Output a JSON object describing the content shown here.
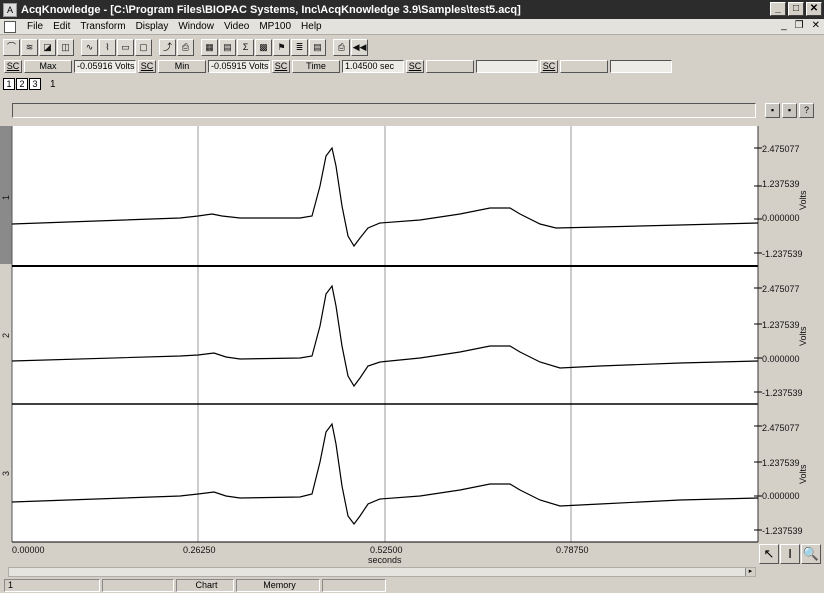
{
  "window": {
    "title": "AcqKnowledge - [C:\\Program Files\\BIOPAC Systems, Inc\\AcqKnowledge 3.9\\Samples\\test5.acq]",
    "buttons": {
      "minimize": "_",
      "maximize": "□",
      "close": "✕"
    }
  },
  "menu": {
    "items": [
      "File",
      "Edit",
      "Transform",
      "Display",
      "Window",
      "Video",
      "MP100",
      "Help"
    ],
    "mdi": {
      "minimize": "_",
      "restore": "❐",
      "close": "✕"
    }
  },
  "toolbar": {
    "icons": [
      "wave-tool-icon",
      "filter-icon",
      "fft-icon",
      "overlap-icon",
      "chart-icon",
      "trend-icon",
      "scope-icon",
      "graph-icon",
      "calc-icon",
      "disk-icon",
      "grid-icon",
      "window-icon",
      "sigma-icon",
      "table-icon",
      "flag-icon",
      "list-icon",
      "notes-icon",
      "print-icon",
      "rewind-icon"
    ],
    "glyphs": [
      "⌒",
      "≋",
      "◪",
      "◫",
      "∿",
      "⌇",
      "▭",
      "▢",
      "⤴",
      "⎙",
      "▦",
      "▤",
      "Σ",
      "▩",
      "⚑",
      "≣",
      "▤",
      "⎙",
      "◀◀"
    ]
  },
  "measurements": [
    {
      "sc": "SC",
      "label": "Max",
      "value": "-0.05916 Volts"
    },
    {
      "sc": "SC",
      "label": "Min",
      "value": "-0.05915 Volts"
    },
    {
      "sc": "SC",
      "label": "Time",
      "value": "1.04500 sec"
    },
    {
      "sc": "SC",
      "label": "",
      "value": ""
    },
    {
      "sc": "SC",
      "label": "",
      "value": ""
    }
  ],
  "channels": {
    "buttons": [
      "1",
      "2",
      "3"
    ],
    "active": "1"
  },
  "journal_buttons": [
    "▪",
    "▪",
    "?"
  ],
  "plot": {
    "y_unit": "Volts",
    "y_ticks": [
      "2.475077",
      "1.237539",
      "0.000000",
      "-1.237539"
    ],
    "x_ticks": [
      "0.00000",
      "0.26250",
      "0.52500",
      "0.78750"
    ],
    "x_label": "seconds",
    "channel_labels": [
      "1",
      "2",
      "3"
    ]
  },
  "tools": [
    "↖",
    "I",
    "🔍"
  ],
  "status": {
    "field1": "1",
    "field2": "",
    "chart": "Chart",
    "memory": "Memory",
    "field5": ""
  }
}
